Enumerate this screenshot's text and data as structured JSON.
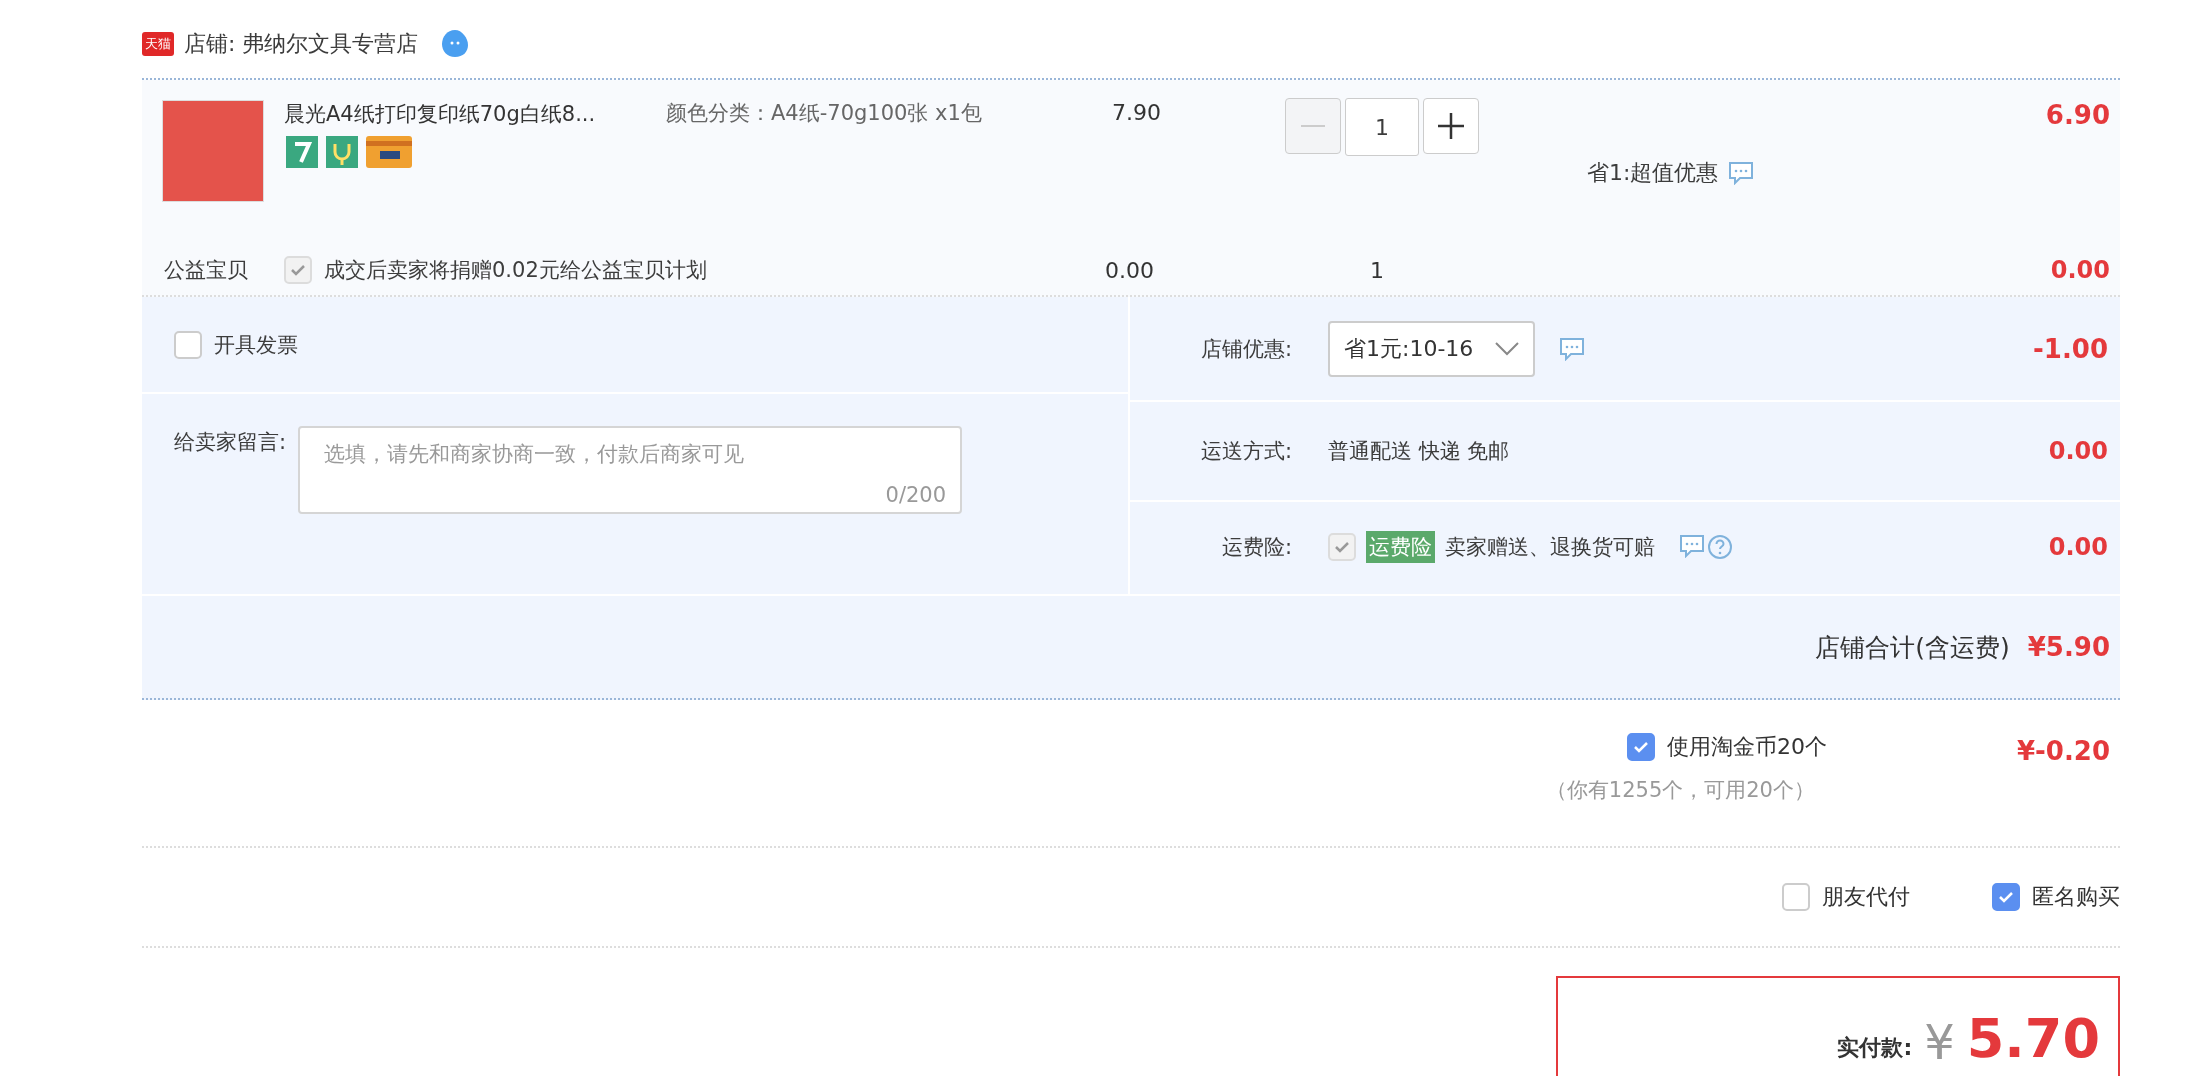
{
  "shop": {
    "platform": "天猫",
    "name": "店铺: 弗纳尔文具专营店"
  },
  "item": {
    "title": "晨光A4纸打印复印纸70g白纸8...",
    "sku": "颜色分类：A4纸-70g100张 x1包",
    "price": "7.90",
    "quantity": "1",
    "minus_disabled": true,
    "promo": "省1:超值优惠",
    "subtotal": "6.90"
  },
  "charity": {
    "label": "公益宝贝",
    "checked": true,
    "disabled": true,
    "text": "成交后卖家将捐赠0.02元给公益宝贝计划",
    "price": "0.00",
    "quantity": "1",
    "subtotal": "0.00"
  },
  "invoice": {
    "label": "开具发票",
    "checked": false
  },
  "message": {
    "label": "给卖家留言:",
    "placeholder": "选填，请先和商家协商一致，付款后商家可见",
    "counter": "0/200"
  },
  "shop_discount": {
    "label": "店铺优惠:",
    "value": "省1元:10-16",
    "amount": "-1.00"
  },
  "shipping": {
    "label": "运送方式:",
    "value": "普通配送 快递 免邮",
    "amount": "0.00"
  },
  "insurance": {
    "label": "运费险:",
    "checked": true,
    "disabled": true,
    "tag": "运费险",
    "text": "卖家赠送、退换货可赔",
    "amount": "0.00"
  },
  "shop_total": {
    "label": "店铺合计(含运费)",
    "amount": "¥5.90"
  },
  "coins": {
    "label": "使用淘金币20个",
    "checked": true,
    "note": "（你有1255个，可用20个）",
    "amount": "¥-0.20"
  },
  "options": [
    {
      "label": "朋友代付",
      "checked": false
    },
    {
      "label": "匿名购买",
      "checked": true
    }
  ],
  "payment": {
    "label": "实付款:",
    "currency": "¥",
    "amount": "5.70"
  }
}
